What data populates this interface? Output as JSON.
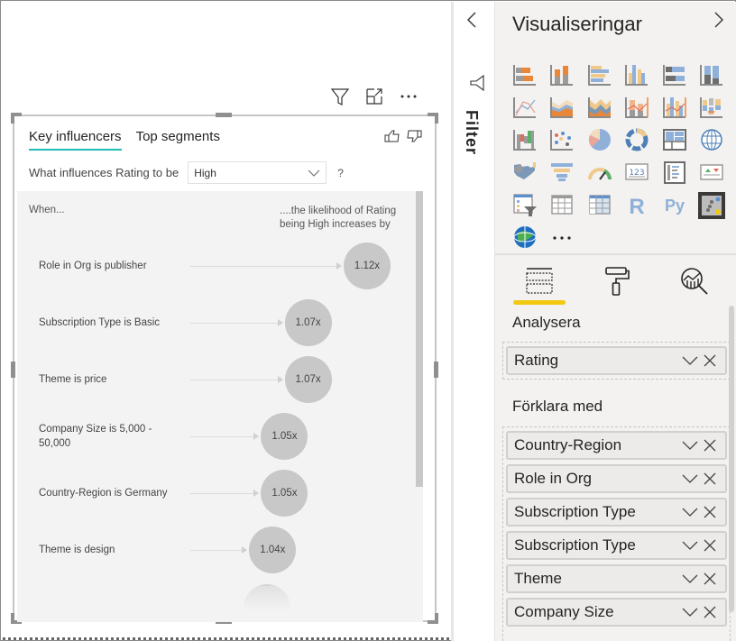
{
  "canvas": {
    "visual_header": {
      "icons": [
        "filter-icon",
        "focus-mode-icon",
        "more-options-icon"
      ]
    },
    "visual": {
      "tabs": [
        {
          "label": "Key influencers",
          "active": true
        },
        {
          "label": "Top segments",
          "active": false
        }
      ],
      "feedback_icons": [
        "thumbs-up-icon",
        "thumbs-down-icon"
      ],
      "question": {
        "label": "What influences Rating to be",
        "selected_value": "High",
        "help": "?"
      },
      "influencers": {
        "when_header": "When...",
        "likelihood_header_line1": "....the likelihood of Rating",
        "likelihood_header_line2": "being High increases by",
        "accent_color": "#1ebfb4",
        "items": [
          {
            "label": "Role in Org is publisher",
            "value": 1.12,
            "display": "1.12x"
          },
          {
            "label": "Subscription Type is Basic",
            "value": 1.07,
            "display": "1.07x"
          },
          {
            "label": "Theme is price",
            "value": 1.07,
            "display": "1.07x"
          },
          {
            "label": "Company Size is 5,000 - 50,000",
            "value": 1.05,
            "display": "1.05x"
          },
          {
            "label": "Country-Region is Germany",
            "value": 1.05,
            "display": "1.05x"
          },
          {
            "label": "Theme is design",
            "value": 1.04,
            "display": "1.04x"
          }
        ]
      }
    }
  },
  "filter_pane": {
    "label": "Filter",
    "collapse_icon": "chevron-left-icon"
  },
  "viz_pane": {
    "title": "Visualiseringar",
    "expand_icon": "chevron-right-icon",
    "visuals": [
      "stacked-bar-chart",
      "stacked-column-chart",
      "clustered-bar-chart",
      "clustered-column-chart",
      "100-stacked-bar-chart",
      "100-stacked-column-chart",
      "line-chart",
      "area-chart",
      "stacked-area-chart",
      "line-and-stacked-column-chart",
      "line-and-clustered-column-chart",
      "ribbon-chart",
      "waterfall-chart",
      "scatter-chart",
      "pie-chart",
      "donut-chart",
      "treemap",
      "map",
      "filled-map",
      "funnel",
      "gauge",
      "card",
      "multi-row-card",
      "kpi",
      "slicer",
      "table",
      "matrix",
      "r-script-visual",
      "python-visual",
      "key-influencers",
      "arcgis-map",
      "more-visuals"
    ],
    "selected_visual": "key-influencers",
    "pane_tabs": [
      {
        "name": "fields",
        "active": true
      },
      {
        "name": "format",
        "active": false
      },
      {
        "name": "analytics",
        "active": false
      }
    ],
    "accent_color": "#f2c811",
    "analyze": {
      "label": "Analysera",
      "fields": [
        "Rating"
      ]
    },
    "explain_by": {
      "label": "Förklara med",
      "fields": [
        "Country-Region",
        "Role in Org",
        "Subscription Type",
        "Subscription Type",
        "Theme",
        "Company Size"
      ]
    }
  }
}
